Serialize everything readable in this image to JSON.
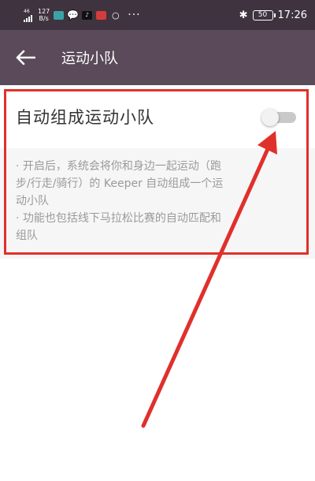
{
  "status_bar": {
    "network_label": "46",
    "speed_value": "127",
    "speed_unit": "B/s",
    "battery": "50",
    "time": "17:26",
    "bluetooth_icon": "bluetooth-icon",
    "app_icons": [
      "notification-app-icon",
      "chat-app-icon",
      "tiktok-app-icon",
      "red-app-icon",
      "circle-app-icon"
    ],
    "more": "···"
  },
  "header": {
    "title": "运动小队",
    "back_icon": "back-arrow-icon"
  },
  "setting": {
    "label": "自动组成运动小队",
    "enabled": false
  },
  "description": {
    "lines": [
      "· 开启后，系统会将你和身边一起运动（跑",
      "步/行走/骑行）的 Keeper 自动组成一个运",
      "动小队",
      "· 功能也包括线下马拉松比赛的自动匹配和",
      "组队"
    ]
  },
  "annotation": {
    "box_color": "#e0302c",
    "arrow_color": "#e0302c"
  }
}
